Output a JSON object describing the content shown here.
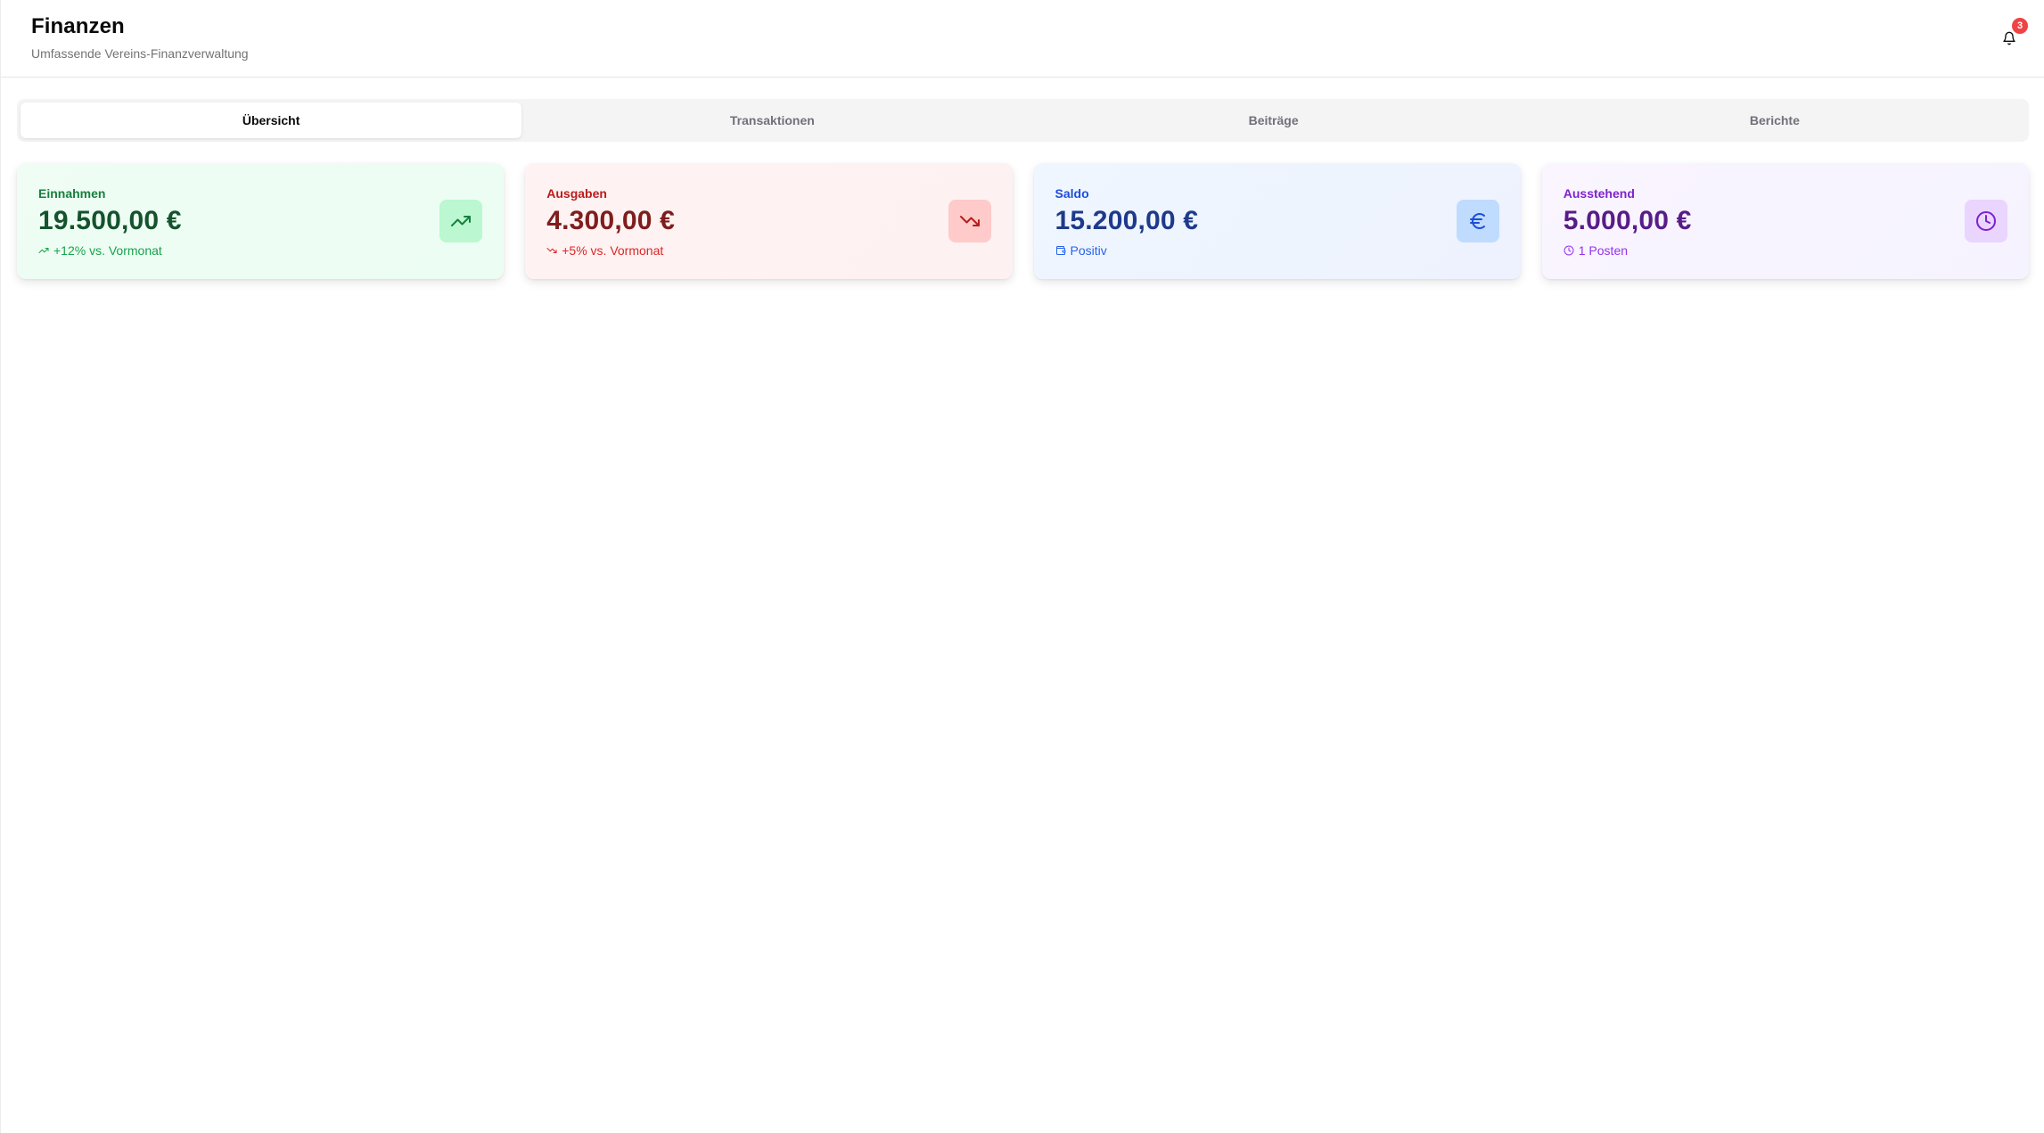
{
  "header": {
    "title": "Finanzen",
    "subtitle": "Umfassende Vereins-Finanzverwaltung",
    "notification_count": "3"
  },
  "tabs": [
    {
      "label": "Übersicht",
      "active": true
    },
    {
      "label": "Transaktionen",
      "active": false
    },
    {
      "label": "Beiträge",
      "active": false
    },
    {
      "label": "Berichte",
      "active": false
    }
  ],
  "cards": [
    {
      "label": "Einnahmen",
      "value": "19.500,00 €",
      "trend": "+12% vs. Vormonat",
      "trend_icon": "trending-up-icon",
      "icon": "trending-up-icon",
      "color": "#15803d"
    },
    {
      "label": "Ausgaben",
      "value": "4.300,00 €",
      "trend": "+5% vs. Vormonat",
      "trend_icon": "trending-down-icon",
      "icon": "trending-down-icon",
      "color": "#b91c1c"
    },
    {
      "label": "Saldo",
      "value": "15.200,00 €",
      "trend": "Positiv",
      "trend_icon": "wallet-icon",
      "icon": "euro-icon",
      "color": "#1d4ed8"
    },
    {
      "label": "Ausstehend",
      "value": "5.000,00 €",
      "trend": "1 Posten",
      "trend_icon": "clock-icon",
      "icon": "clock-icon",
      "color": "#7e22ce"
    }
  ]
}
